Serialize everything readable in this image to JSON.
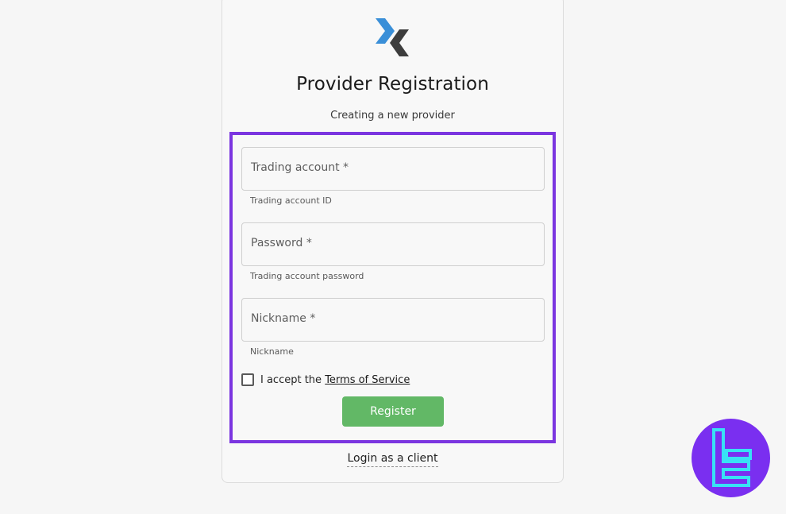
{
  "form": {
    "title": "Provider Registration",
    "subtitle": "Creating a new provider",
    "fields": [
      {
        "label": "Trading account *",
        "hint": "Trading account ID"
      },
      {
        "label": "Password *",
        "hint": "Trading account password"
      },
      {
        "label": "Nickname *",
        "hint": "Nickname"
      }
    ],
    "accept_prefix": "I accept the",
    "terms_link": "Terms of Service",
    "register_label": "Register",
    "login_link": "Login as a client"
  },
  "colors": {
    "highlight_border": "#7b35e0",
    "register_button": "#62b866",
    "logo_blue": "#3a8fd8",
    "logo_dark": "#3d3d3d",
    "badge": "#7a2ff0",
    "badge_glyph": "#38e1f5"
  },
  "icons": {
    "logo": "chevron-logo-icon",
    "badge": "tradingfinder-badge-icon"
  }
}
